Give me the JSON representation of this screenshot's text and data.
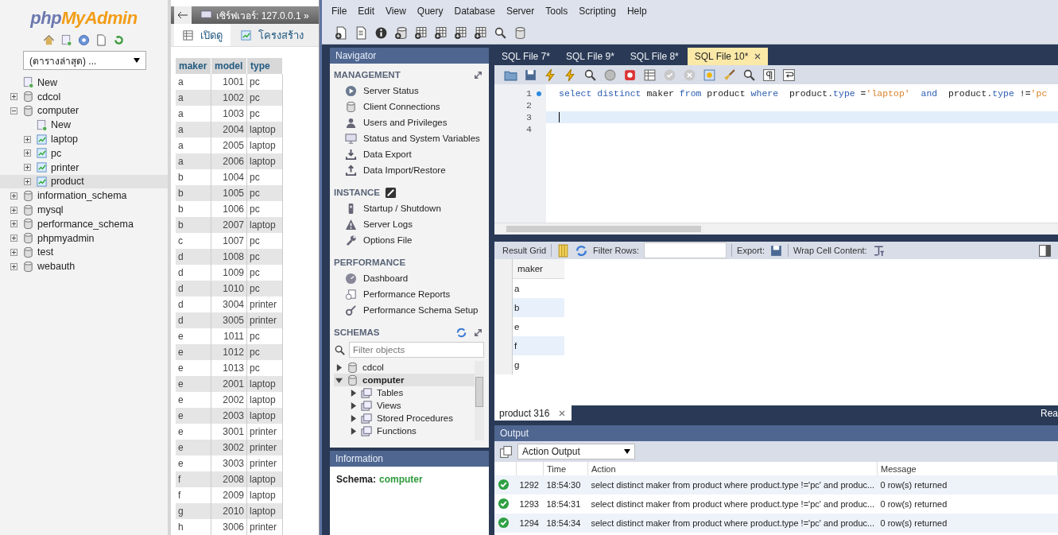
{
  "pma_nav": {
    "logo": [
      "php",
      "MyAdmin"
    ],
    "db_select": "(ตารางล่าสุด) ...",
    "tree": [
      {
        "label": "New",
        "kind": "new",
        "selected": false
      },
      {
        "label": "cdcol",
        "kind": "db",
        "expanded": false,
        "selected": false
      },
      {
        "label": "computer",
        "kind": "db",
        "expanded": true,
        "selected": false,
        "children": [
          {
            "label": "New",
            "kind": "new",
            "selected": false
          },
          {
            "label": "laptop",
            "kind": "table",
            "expanded": false,
            "selected": false
          },
          {
            "label": "pc",
            "kind": "table",
            "expanded": false,
            "selected": false
          },
          {
            "label": "printer",
            "kind": "table",
            "expanded": false,
            "selected": false
          },
          {
            "label": "product",
            "kind": "table",
            "expanded": false,
            "selected": true
          }
        ]
      },
      {
        "label": "information_schema",
        "kind": "db",
        "expanded": false,
        "selected": false
      },
      {
        "label": "mysql",
        "kind": "db",
        "expanded": false,
        "selected": false
      },
      {
        "label": "performance_schema",
        "kind": "db",
        "expanded": false,
        "selected": false
      },
      {
        "label": "phpmyadmin",
        "kind": "db",
        "expanded": false,
        "selected": false
      },
      {
        "label": "test",
        "kind": "db",
        "expanded": false,
        "selected": false
      },
      {
        "label": "webauth",
        "kind": "db",
        "expanded": false,
        "selected": false
      }
    ]
  },
  "pma_main": {
    "breadcrumb": "เซิร์ฟเวอร์: 127.0.0.1 »",
    "tabs": [
      {
        "label": "เปิดดู",
        "selected": true
      },
      {
        "label": "โครงสร้าง",
        "selected": false
      }
    ],
    "table": {
      "columns": [
        "maker",
        "model",
        "type"
      ],
      "rows": [
        [
          "a",
          "1001",
          "pc"
        ],
        [
          "a",
          "1002",
          "pc"
        ],
        [
          "a",
          "1003",
          "pc"
        ],
        [
          "a",
          "2004",
          "laptop"
        ],
        [
          "a",
          "2005",
          "laptop"
        ],
        [
          "a",
          "2006",
          "laptop"
        ],
        [
          "b",
          "1004",
          "pc"
        ],
        [
          "b",
          "1005",
          "pc"
        ],
        [
          "b",
          "1006",
          "pc"
        ],
        [
          "b",
          "2007",
          "laptop"
        ],
        [
          "c",
          "1007",
          "pc"
        ],
        [
          "d",
          "1008",
          "pc"
        ],
        [
          "d",
          "1009",
          "pc"
        ],
        [
          "d",
          "1010",
          "pc"
        ],
        [
          "d",
          "3004",
          "printer"
        ],
        [
          "d",
          "3005",
          "printer"
        ],
        [
          "e",
          "1011",
          "pc"
        ],
        [
          "e",
          "1012",
          "pc"
        ],
        [
          "e",
          "1013",
          "pc"
        ],
        [
          "e",
          "2001",
          "laptop"
        ],
        [
          "e",
          "2002",
          "laptop"
        ],
        [
          "e",
          "2003",
          "laptop"
        ],
        [
          "e",
          "3001",
          "printer"
        ],
        [
          "e",
          "3002",
          "printer"
        ],
        [
          "e",
          "3003",
          "printer"
        ],
        [
          "f",
          "2008",
          "laptop"
        ],
        [
          "f",
          "2009",
          "laptop"
        ],
        [
          "g",
          "2010",
          "laptop"
        ],
        [
          "h",
          "3006",
          "printer"
        ]
      ]
    }
  },
  "workbench": {
    "menu": [
      "File",
      "Edit",
      "View",
      "Query",
      "Database",
      "Server",
      "Tools",
      "Scripting",
      "Help"
    ],
    "navigator": {
      "title": "Navigator",
      "sections": [
        {
          "title": "MANAGEMENT",
          "items": [
            "Server Status",
            "Client Connections",
            "Users and Privileges",
            "Status and System Variables",
            "Data Export",
            "Data Import/Restore"
          ]
        },
        {
          "title": "INSTANCE",
          "items": [
            "Startup / Shutdown",
            "Server Logs",
            "Options File"
          ]
        },
        {
          "title": "PERFORMANCE",
          "items": [
            "Dashboard",
            "Performance Reports",
            "Performance Schema Setup"
          ]
        }
      ],
      "schemas": {
        "title": "SCHEMAS",
        "filter_placeholder": "Filter objects",
        "tree": [
          {
            "label": "cdcol",
            "expanded": false,
            "selected": false
          },
          {
            "label": "computer",
            "expanded": true,
            "selected": true,
            "children": [
              {
                "label": "Tables",
                "expanded": false
              },
              {
                "label": "Views",
                "expanded": false
              },
              {
                "label": "Stored Procedures",
                "expanded": false
              },
              {
                "label": "Functions",
                "expanded": false
              }
            ]
          }
        ]
      }
    },
    "information": {
      "title": "Information",
      "label": "Schema:",
      "value": "computer"
    },
    "editor": {
      "tabs": [
        {
          "label": "SQL File 7*",
          "selected": false
        },
        {
          "label": "SQL File 9*",
          "selected": false
        },
        {
          "label": "SQL File 8*",
          "selected": false
        },
        {
          "label": "SQL File 10*",
          "selected": true
        }
      ],
      "lines": [
        {
          "number": "1",
          "marker": true,
          "current": false,
          "tokens": [
            {
              "text": "select distinct",
              "kind": "keyword"
            },
            {
              "text": " maker ",
              "kind": "plain"
            },
            {
              "text": "from",
              "kind": "keyword"
            },
            {
              "text": " product ",
              "kind": "plain"
            },
            {
              "text": "where",
              "kind": "keyword"
            },
            {
              "text": "  product.",
              "kind": "plain"
            },
            {
              "text": "type",
              "kind": "keyword"
            },
            {
              "text": " =",
              "kind": "plain"
            },
            {
              "text": "'laptop'",
              "kind": "string"
            },
            {
              "text": "  and",
              "kind": "keyword"
            },
            {
              "text": "  product.",
              "kind": "plain"
            },
            {
              "text": "type",
              "kind": "keyword"
            },
            {
              "text": " !=",
              "kind": "plain"
            },
            {
              "text": "'pc",
              "kind": "string"
            }
          ]
        },
        {
          "number": "2",
          "marker": false,
          "current": false
        },
        {
          "number": "3",
          "marker": false,
          "current": true
        },
        {
          "number": "4",
          "marker": false,
          "current": false
        }
      ]
    },
    "result": {
      "grid_label": "Result Grid",
      "filter_label": "Filter Rows:",
      "export_label": "Export:",
      "wrap_label": "Wrap Cell Content:",
      "columns": [
        "maker"
      ],
      "rows": [
        "a",
        "b",
        "e",
        "f",
        "g"
      ],
      "tab": "product 316",
      "status": "Rea"
    },
    "output": {
      "title": "Output",
      "selector": "Action Output",
      "columns": [
        "Time",
        "Action",
        "Message"
      ],
      "rows": [
        {
          "number": "1292",
          "time": "18:54:30",
          "action": "select distinct maker from product where  product.type !='pc'  and  produc...",
          "message": "0 row(s) returned"
        },
        {
          "number": "1293",
          "time": "18:54:31",
          "action": "select distinct maker from product where  product.type !='pc'  and  produc...",
          "message": "0 row(s) returned"
        },
        {
          "number": "1294",
          "time": "18:54:34",
          "action": "select distinct maker from product where  product.type !='pc'  and  produc...",
          "message": "0 row(s) returned"
        }
      ]
    }
  }
}
